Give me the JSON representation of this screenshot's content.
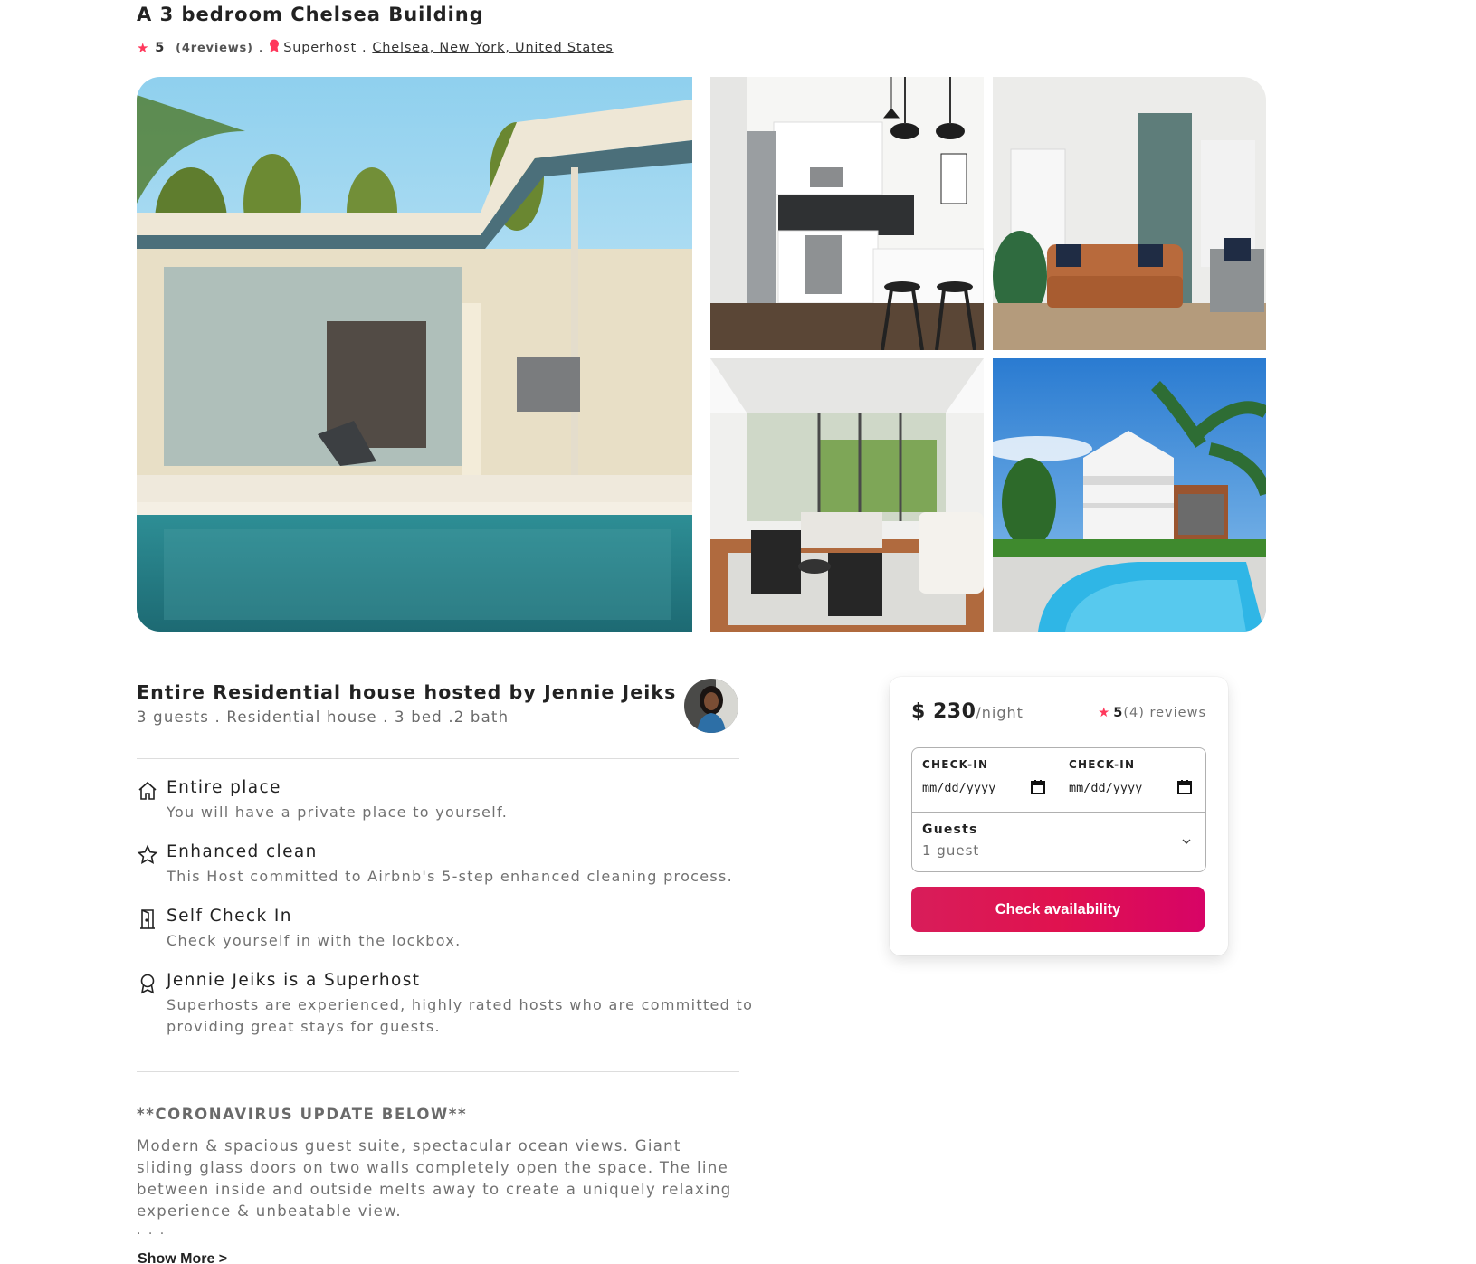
{
  "listing": {
    "title": "A 3 bedroom Chelsea Building",
    "rating": "5",
    "reviews_label": "(4reviews)",
    "sep1": ".",
    "superhost_label": "Superhost",
    "sep2": ".",
    "location": "Chelsea, New York, United States"
  },
  "gallery": {
    "photos": [
      "pool-house-photo",
      "kitchen-photo",
      "living-room-photo",
      "lounge-photo",
      "house-with-pool-photo"
    ]
  },
  "host": {
    "title": "Entire Residential house hosted by Jennie Jeiks",
    "subtitle": "3 guests . Residential house . 3 bed .2 bath"
  },
  "features": [
    {
      "icon": "home-icon",
      "title": "Entire place",
      "desc": "You will have a private place to yourself."
    },
    {
      "icon": "star-outline-icon",
      "title": "Enhanced clean",
      "desc": "This Host committed to Airbnb's 5-step enhanced cleaning process."
    },
    {
      "icon": "door-icon",
      "title": "Self Check In",
      "desc": "Check yourself in with the lockbox."
    },
    {
      "icon": "award-icon",
      "title": "Jennie Jeiks is a Superhost",
      "desc": "Superhosts are experienced, highly rated hosts who are committed to providing great stays for guests."
    }
  ],
  "description": {
    "heading": "**CORONAVIRUS UPDATE BELOW**",
    "body": "Modern & spacious guest suite, spectacular ocean views. Giant sliding glass doors on two walls completely open the space. The line between inside and outside melts away to create a uniquely relaxing experience & unbeatable view.",
    "ellipsis": ". . .",
    "show_more": "Show More >"
  },
  "booking": {
    "price": "$ 230",
    "per_night": "/night",
    "rating": "5",
    "reviews": "(4) reviews",
    "checkin_label": "CHECK-IN",
    "checkin_value": "mm/dd/yyyy",
    "checkout_label": "CHECK-IN",
    "checkout_value": "mm/dd/yyyy",
    "guests_label": "Guests",
    "guests_value": "1 guest",
    "button_label": "Check availability"
  },
  "colors": {
    "accent": "#ff385c",
    "button": "#e0124f",
    "muted_text": "#717171"
  }
}
